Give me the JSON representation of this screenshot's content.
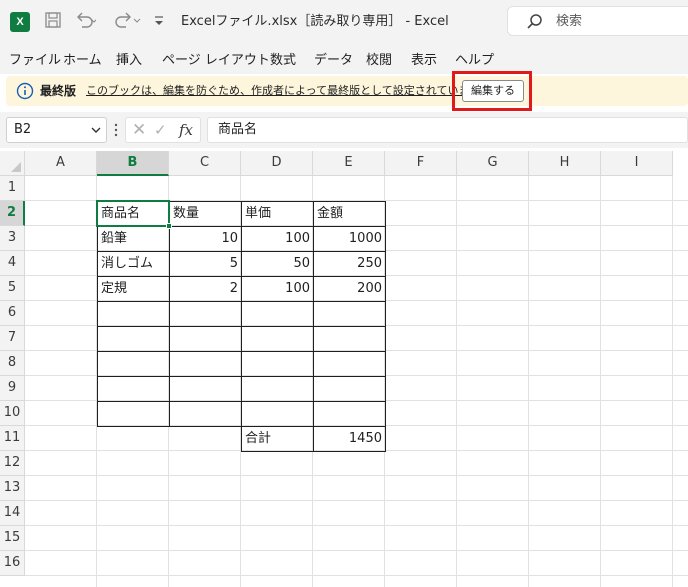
{
  "title_bar": {
    "app_logo": "X",
    "title": "Excelファイル.xlsx［読み取り専用］ - Excel",
    "search_placeholder": "検索",
    "icons": [
      "save-icon",
      "undo-icon",
      "redo-icon",
      "customize-qat-icon",
      "search-icon"
    ]
  },
  "menu": {
    "items": [
      "ファイル",
      "ホーム",
      "挿入",
      "ページ レイアウト",
      "数式",
      "データ",
      "校閲",
      "表示",
      "ヘルプ"
    ]
  },
  "message_bar": {
    "title": "最終版",
    "text": "このブックは、編集を防ぐため、作成者によって最終版として設定されています。",
    "button": "編集する",
    "highlight_color": "#e0191b",
    "background_color": "#fdf6dc"
  },
  "formula_bar": {
    "name_box": "B2",
    "fx": "fx",
    "formula": "商品名"
  },
  "grid": {
    "columns": [
      "A",
      "B",
      "C",
      "D",
      "E",
      "F",
      "G",
      "H",
      "I"
    ],
    "rows": [
      "1",
      "2",
      "3",
      "4",
      "5",
      "6",
      "7",
      "8",
      "9",
      "10",
      "11",
      "12",
      "13",
      "14",
      "15",
      "16"
    ],
    "selected_cell": "B2",
    "accent_color": "#107c41",
    "cells": {
      "B2": "商品名",
      "C2": "数量",
      "D2": "単価",
      "E2": "金額",
      "B3": "鉛筆",
      "C3": "10",
      "D3": "100",
      "E3": "1000",
      "B4": "消しゴム",
      "C4": "5",
      "D4": "50",
      "E4": "250",
      "B5": "定規",
      "C5": "2",
      "D5": "100",
      "E5": "200",
      "D11": "合計",
      "E11": "1450"
    }
  }
}
